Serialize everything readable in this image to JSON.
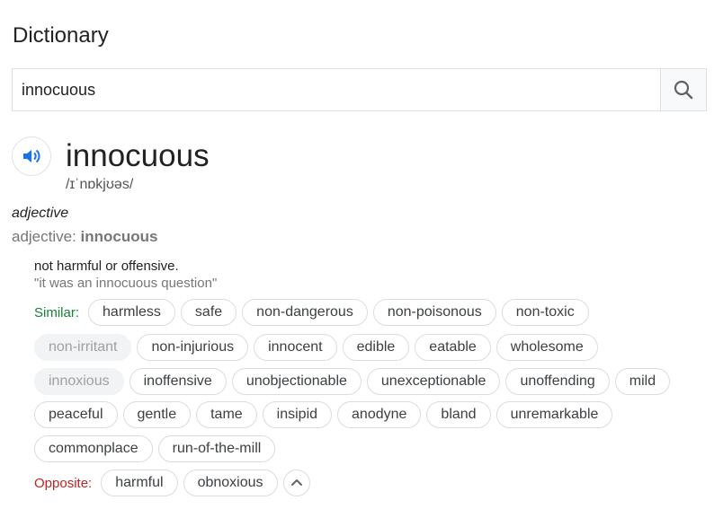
{
  "header": {
    "title": "Dictionary"
  },
  "search": {
    "value": "innocuous"
  },
  "entry": {
    "word": "innocuous",
    "phonetic": "/ɪˈnɒkjʊəs/",
    "part_of_speech": "adjective",
    "forms_prefix": "adjective: ",
    "forms_word": "innocuous",
    "definition": "not harmful or offensive.",
    "example": "\"it was an innocuous question\""
  },
  "similar": {
    "label": "Similar:",
    "rows": [
      [
        "harmless",
        "safe",
        "non-dangerous",
        "non-poisonous",
        "non-toxic"
      ],
      [
        "non-irritant",
        "non-injurious",
        "innocent",
        "edible",
        "eatable",
        "wholesome"
      ],
      [
        "innoxious",
        "inoffensive",
        "unobjectionable",
        "unexceptionable",
        "unoffending",
        "mild"
      ],
      [
        "peaceful",
        "gentle",
        "tame",
        "insipid",
        "anodyne",
        "bland",
        "unremarkable"
      ],
      [
        "commonplace",
        "run-of-the-mill"
      ]
    ],
    "disabled": [
      "non-irritant",
      "innoxious"
    ]
  },
  "opposite": {
    "label": "Opposite:",
    "items": [
      "harmful",
      "obnoxious"
    ]
  },
  "icons": {
    "search": "search-icon",
    "speaker": "speaker-icon",
    "collapse": "chevron-up-icon"
  },
  "colors": {
    "similar_label": "#188038",
    "opposite_label": "#c5221f",
    "speaker": "#1a73e8"
  }
}
